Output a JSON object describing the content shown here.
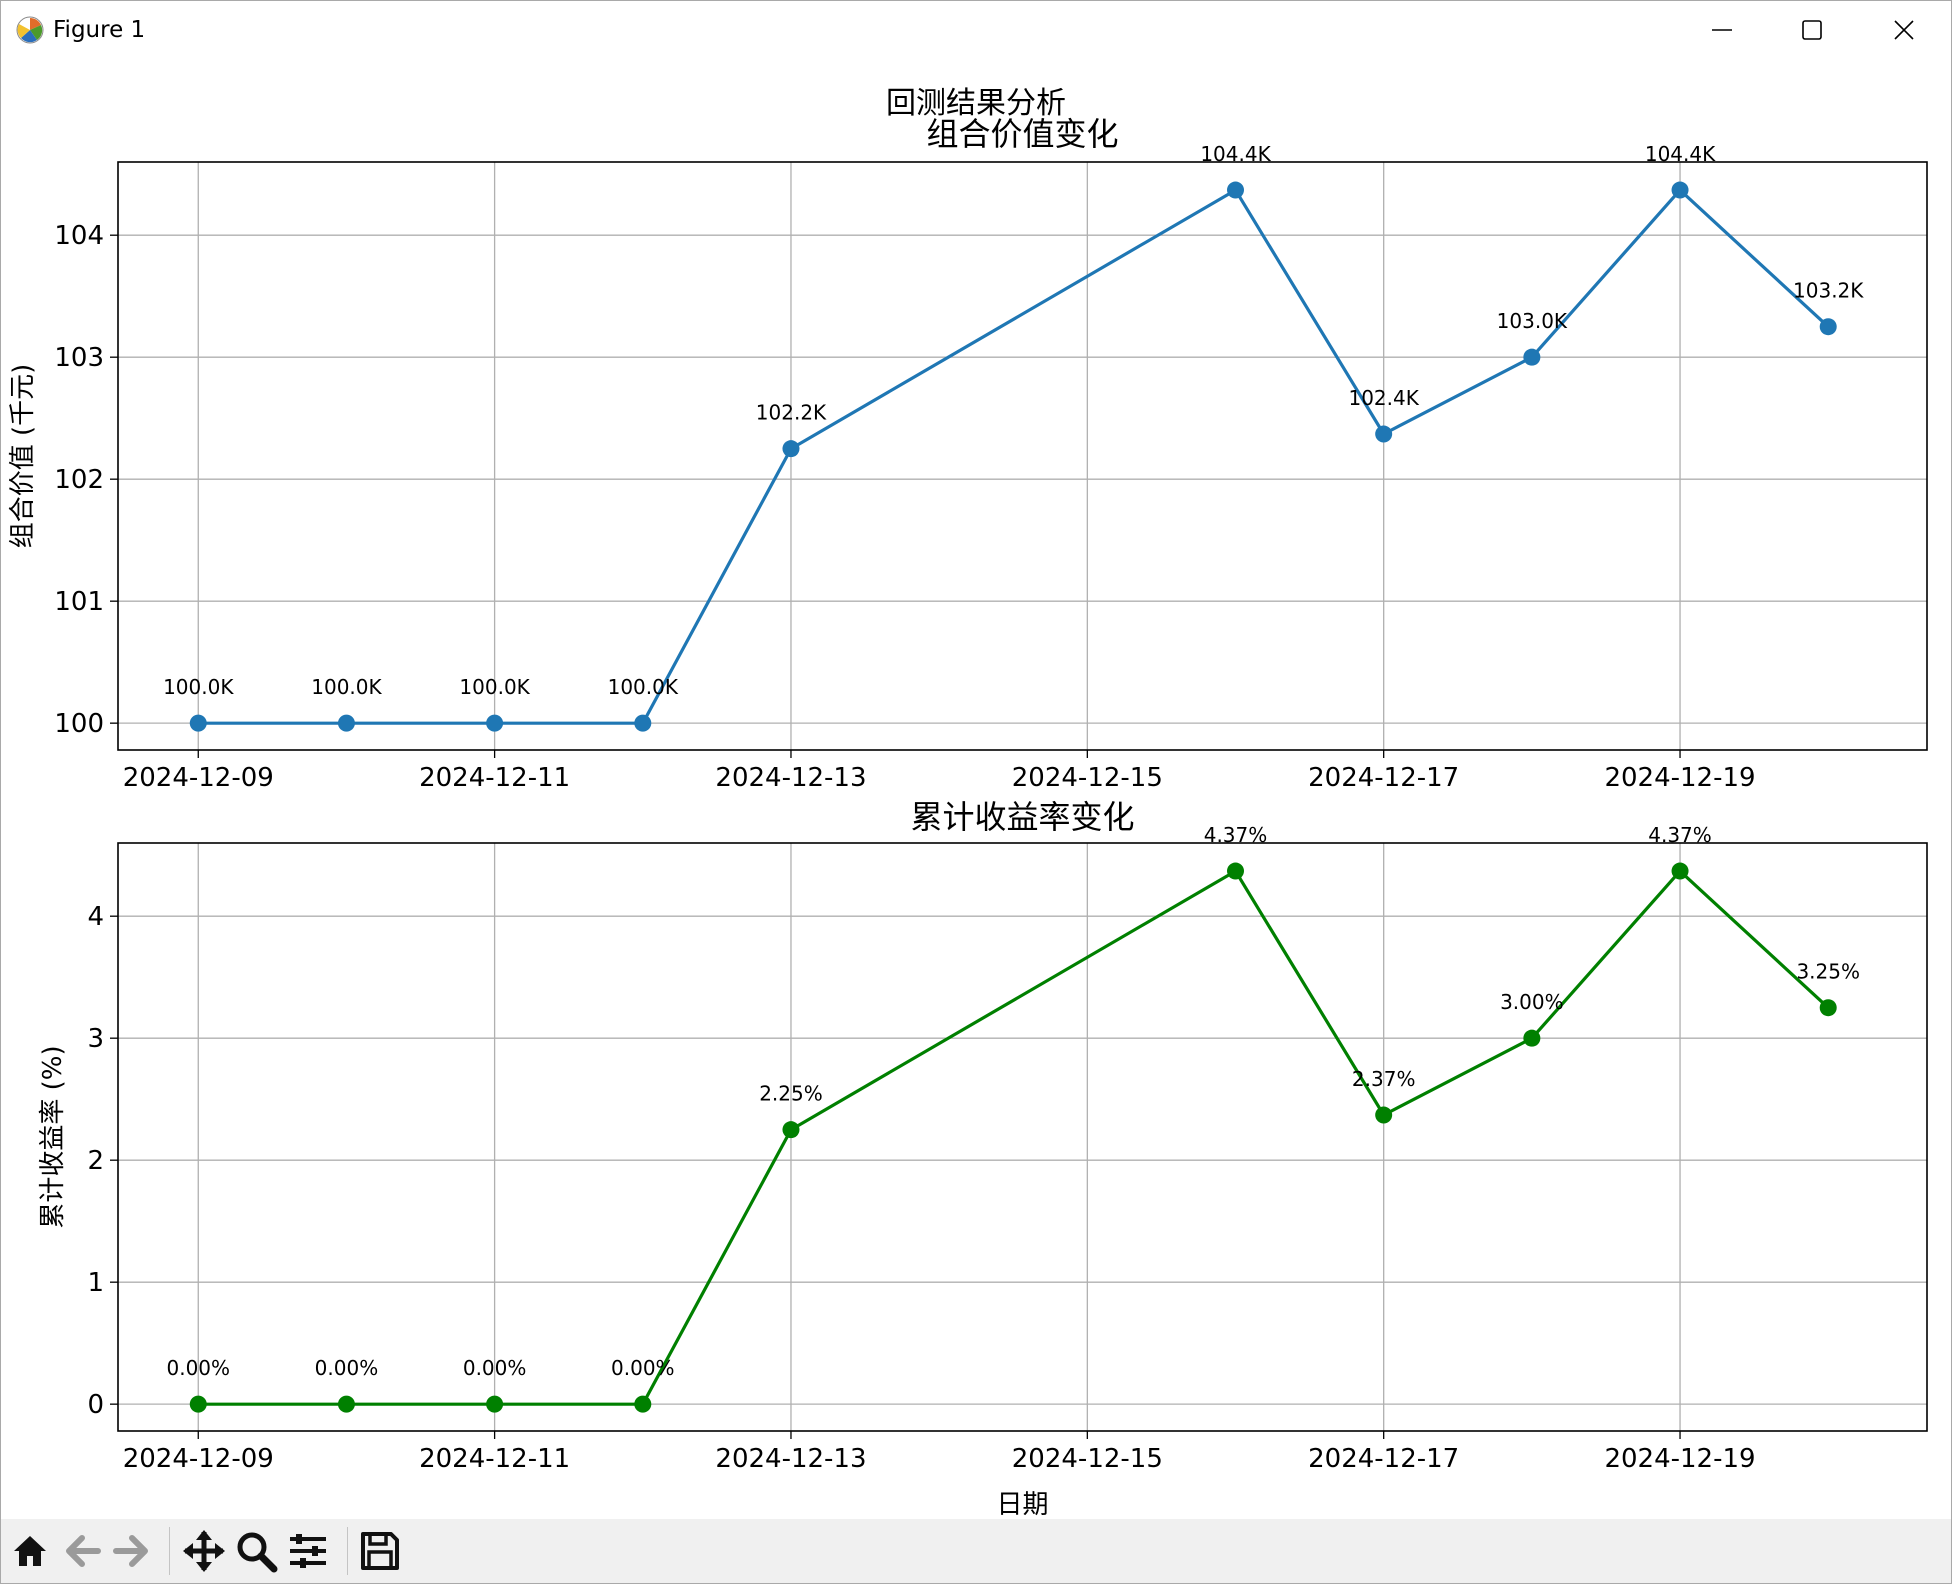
{
  "window": {
    "title": "Figure 1"
  },
  "toolbar": {
    "buttons": [
      "home-icon",
      "back-arrow-icon",
      "forward-arrow-icon",
      "pan-icon",
      "zoom-icon",
      "configure-subplots-icon",
      "save-icon"
    ]
  },
  "figure": {
    "suptitle": "回测结果分析"
  },
  "colors": {
    "line1": "#1f77b4",
    "line2": "#008000",
    "grid": "#b0b0b0"
  },
  "chart_data": [
    {
      "type": "line",
      "title": "组合价值变化",
      "xlabel": "",
      "ylabel": "组合价值 (千元)",
      "x": [
        "2024-12-09",
        "2024-12-10",
        "2024-12-11",
        "2024-12-12",
        "2024-12-13",
        "2024-12-16",
        "2024-12-17",
        "2024-12-18",
        "2024-12-19",
        "2024-12-20"
      ],
      "values": [
        100.0,
        100.0,
        100.0,
        100.0,
        102.25,
        104.37,
        102.37,
        103.0,
        104.37,
        103.25
      ],
      "data_labels": [
        "100.0K",
        "100.0K",
        "100.0K",
        "100.0K",
        "102.2K",
        "104.4K",
        "102.4K",
        "103.0K",
        "104.4K",
        "103.2K"
      ],
      "xticks": [
        "2024-12-09",
        "2024-12-11",
        "2024-12-13",
        "2024-12-15",
        "2024-12-17",
        "2024-12-19"
      ],
      "yticks": [
        100,
        101,
        102,
        103,
        104
      ],
      "xlim": [
        "2024-12-08T11:00",
        "2024-12-20T16:00"
      ],
      "ylim": [
        99.78,
        104.6
      ],
      "grid": true,
      "color": "#1f77b4",
      "marker": "circle"
    },
    {
      "type": "line",
      "title": "累计收益率变化",
      "xlabel": "日期",
      "ylabel": "累计收益率 (%)",
      "x": [
        "2024-12-09",
        "2024-12-10",
        "2024-12-11",
        "2024-12-12",
        "2024-12-13",
        "2024-12-16",
        "2024-12-17",
        "2024-12-18",
        "2024-12-19",
        "2024-12-20"
      ],
      "values": [
        0.0,
        0.0,
        0.0,
        0.0,
        2.25,
        4.37,
        2.37,
        3.0,
        4.37,
        3.25
      ],
      "data_labels": [
        "0.00%",
        "0.00%",
        "0.00%",
        "0.00%",
        "2.25%",
        "4.37%",
        "2.37%",
        "3.00%",
        "4.37%",
        "3.25%"
      ],
      "xticks": [
        "2024-12-09",
        "2024-12-11",
        "2024-12-13",
        "2024-12-15",
        "2024-12-17",
        "2024-12-19"
      ],
      "yticks": [
        0,
        1,
        2,
        3,
        4
      ],
      "xlim": [
        "2024-12-08T11:00",
        "2024-12-20T16:00"
      ],
      "ylim": [
        -0.22,
        4.6
      ],
      "grid": true,
      "color": "#008000",
      "marker": "circle"
    }
  ]
}
